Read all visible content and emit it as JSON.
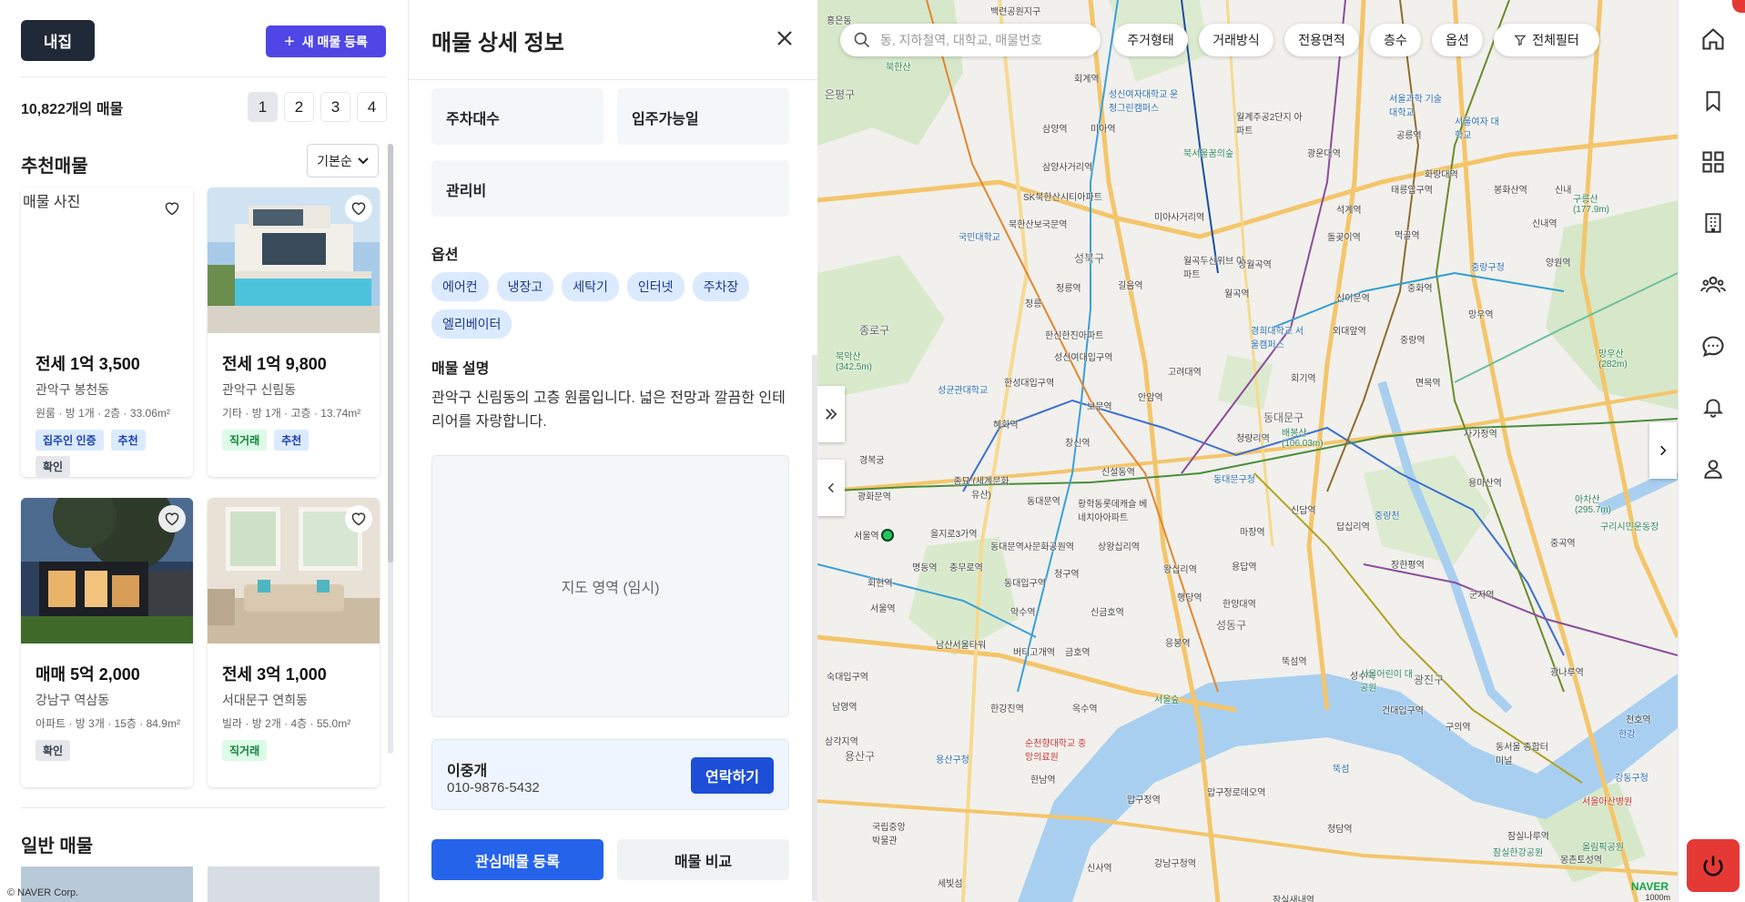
{
  "list_panel": {
    "my_button": "내집",
    "new_listing_button": "새 매물 등록",
    "count_text": "10,822개의 매물",
    "pages": [
      "1",
      "2",
      "3",
      "4"
    ],
    "active_page": "1",
    "recommended_title": "추천매물",
    "sort_value": "기본순",
    "general_title": "일반 매물",
    "broken_image_alt": "매물 사진",
    "cards": [
      {
        "price": "전세 1억 3,500",
        "location": "관악구 봉천동",
        "meta": "원룸 · 방 1개 · 2층 · 33.06m²",
        "badges": [
          {
            "text": "집주인 인증",
            "color": "blue"
          },
          {
            "text": "추천",
            "color": "blue"
          },
          {
            "text": "확인",
            "color": "gray"
          }
        ]
      },
      {
        "price": "전세 1억 9,800",
        "location": "관악구 신림동",
        "meta": "기타 · 방 1개 · 고층 · 13.74m²",
        "badges": [
          {
            "text": "직거래",
            "color": "green"
          },
          {
            "text": "추천",
            "color": "blue"
          }
        ]
      },
      {
        "price": "매매 5억 2,000",
        "location": "강남구 역삼동",
        "meta": "아파트 · 방 3개 · 15층 · 84.9m²",
        "badges": [
          {
            "text": "확인",
            "color": "gray"
          }
        ]
      },
      {
        "price": "전세 3억 1,000",
        "location": "서대문구 연희동",
        "meta": "빌라 · 방 2개 · 4층 · 55.0m²",
        "badges": [
          {
            "text": "직거래",
            "color": "green"
          }
        ]
      }
    ],
    "footer": "© NAVER Corp."
  },
  "detail": {
    "title": "매물 상세 정보",
    "info_boxes": [
      "주차대수",
      "입주가능일",
      "관리비"
    ],
    "options_title": "옵션",
    "options": [
      "에어컨",
      "냉장고",
      "세탁기",
      "인터넷",
      "주차장",
      "엘리베이터"
    ],
    "description_title": "매물 설명",
    "description": "관악구 신림동의 고층 원룸입니다. 넓은 전망과 깔끔한 인테리어를 자랑합니다.",
    "map_placeholder": "지도 영역 (임시)",
    "agent_name": "이중개",
    "agent_phone": "010-9876-5432",
    "contact_button": "연락하기",
    "favorite_button": "관심매물 등록",
    "compare_button": "매물 비교"
  },
  "map": {
    "search_placeholder": "동, 지하철역, 대학교, 매물번호",
    "filters": [
      "주거형태",
      "거래방식",
      "전용면적",
      "층수",
      "옵션",
      "전체필터"
    ],
    "brand": "NAVER",
    "scale": "1000m",
    "labels": [
      {
        "t": "백련공원지구",
        "c": ""
      },
      {
        "t": "은평구",
        "c": "big"
      },
      {
        "t": "홍은동",
        "c": ""
      },
      {
        "t": "북한산",
        "c": "green"
      },
      {
        "t": "회계역",
        "c": ""
      },
      {
        "t": "성신여자대학교 운정그린캠퍼스",
        "c": "blue"
      },
      {
        "t": "월계주공2단지 아파트",
        "c": ""
      },
      {
        "t": "서울과학 기술대학교",
        "c": "blue"
      },
      {
        "t": "서울여자 대학교",
        "c": "blue"
      },
      {
        "t": "삼양역",
        "c": ""
      },
      {
        "t": "미아역",
        "c": ""
      },
      {
        "t": "북서울꿈의숲",
        "c": "green"
      },
      {
        "t": "광운대역",
        "c": ""
      },
      {
        "t": "공릉역",
        "c": ""
      },
      {
        "t": "화랑대역",
        "c": ""
      },
      {
        "t": "봉화산역",
        "c": ""
      },
      {
        "t": "신내",
        "c": ""
      },
      {
        "t": "삼양사거리역",
        "c": ""
      },
      {
        "t": "석계역",
        "c": ""
      },
      {
        "t": "태릉입구역",
        "c": ""
      },
      {
        "t": "구릉산 (177.9m)",
        "c": "green"
      },
      {
        "t": "신내역",
        "c": ""
      },
      {
        "t": "미아사거리역",
        "c": ""
      },
      {
        "t": "SK북한산시티아파트",
        "c": ""
      },
      {
        "t": "북한산보국문역",
        "c": ""
      },
      {
        "t": "국민대학교",
        "c": "blue"
      },
      {
        "t": "돌곶이역",
        "c": ""
      },
      {
        "t": "먹골역",
        "c": ""
      },
      {
        "t": "중랑구청",
        "c": "blue"
      },
      {
        "t": "양원역",
        "c": ""
      },
      {
        "t": "성북구",
        "c": "big"
      },
      {
        "t": "월곡두산위브 아파트",
        "c": ""
      },
      {
        "t": "상월곡역",
        "c": ""
      },
      {
        "t": "정릉역",
        "c": ""
      },
      {
        "t": "길음역",
        "c": ""
      },
      {
        "t": "정릉",
        "c": ""
      },
      {
        "t": "월곡역",
        "c": ""
      },
      {
        "t": "신이문역",
        "c": ""
      },
      {
        "t": "중화역",
        "c": ""
      },
      {
        "t": "망우역",
        "c": ""
      },
      {
        "t": "종로구",
        "c": "big"
      },
      {
        "t": "한신한진아파트",
        "c": ""
      },
      {
        "t": "북악산 (342.5m)",
        "c": "green"
      },
      {
        "t": "경희대학교 서울캠퍼스",
        "c": "blue"
      },
      {
        "t": "외대앞역",
        "c": ""
      },
      {
        "t": "중랑역",
        "c": ""
      },
      {
        "t": "망우산 (282m)",
        "c": "green"
      },
      {
        "t": "성신여대입구역",
        "c": ""
      },
      {
        "t": "고려대역",
        "c": ""
      },
      {
        "t": "회기역",
        "c": ""
      },
      {
        "t": "면목역",
        "c": ""
      },
      {
        "t": "성균관대학교",
        "c": "blue"
      },
      {
        "t": "한성대입구역",
        "c": ""
      },
      {
        "t": "안암역",
        "c": ""
      },
      {
        "t": "보문역",
        "c": ""
      },
      {
        "t": "동대문구",
        "c": "big"
      },
      {
        "t": "배봉산 (106.03m)",
        "c": "green"
      },
      {
        "t": "혜화역",
        "c": ""
      },
      {
        "t": "청량리역",
        "c": ""
      },
      {
        "t": "사가정역",
        "c": ""
      },
      {
        "t": "경복궁",
        "c": ""
      },
      {
        "t": "창신역",
        "c": ""
      },
      {
        "t": "신설동역",
        "c": ""
      },
      {
        "t": "동대문구청",
        "c": "blue"
      },
      {
        "t": "용마산역",
        "c": ""
      },
      {
        "t": "종묘 (세계문화유산)",
        "c": ""
      },
      {
        "t": "광화문역",
        "c": ""
      },
      {
        "t": "동대문역",
        "c": ""
      },
      {
        "t": "황학동롯데캐슬 베네치아아파트",
        "c": ""
      },
      {
        "t": "신답역",
        "c": ""
      },
      {
        "t": "답십리역",
        "c": ""
      },
      {
        "t": "중랑천",
        "c": "blue"
      },
      {
        "t": "아차산 (295.7m)",
        "c": "green"
      },
      {
        "t": "구리시민운동장",
        "c": "green"
      },
      {
        "t": "서울역",
        "c": ""
      },
      {
        "t": "을지로3가역",
        "c": ""
      },
      {
        "t": "동대문역사문화공원역",
        "c": ""
      },
      {
        "t": "상왕십리역",
        "c": ""
      },
      {
        "t": "마장역",
        "c": ""
      },
      {
        "t": "장한평역",
        "c": ""
      },
      {
        "t": "군자역",
        "c": ""
      },
      {
        "t": "중곡역",
        "c": ""
      },
      {
        "t": "명동역",
        "c": ""
      },
      {
        "t": "충무로역",
        "c": ""
      },
      {
        "t": "청구역",
        "c": ""
      },
      {
        "t": "왕십리역",
        "c": ""
      },
      {
        "t": "용답역",
        "c": ""
      },
      {
        "t": "회현역",
        "c": ""
      },
      {
        "t": "동대입구역",
        "c": ""
      },
      {
        "t": "행당역",
        "c": ""
      },
      {
        "t": "서울역",
        "c": ""
      },
      {
        "t": "약수역",
        "c": ""
      },
      {
        "t": "신금호역",
        "c": ""
      },
      {
        "t": "한양대역",
        "c": ""
      },
      {
        "t": "성동구",
        "c": "big"
      },
      {
        "t": "남산서울타워",
        "c": ""
      },
      {
        "t": "버티고개역",
        "c": ""
      },
      {
        "t": "금호역",
        "c": ""
      },
      {
        "t": "응봉역",
        "c": ""
      },
      {
        "t": "뚝섬역",
        "c": ""
      },
      {
        "t": "성수역",
        "c": ""
      },
      {
        "t": "서울어린이 대공원",
        "c": "green"
      },
      {
        "t": "광진구",
        "c": "big"
      },
      {
        "t": "광나루역",
        "c": ""
      },
      {
        "t": "숙대입구역",
        "c": ""
      },
      {
        "t": "옥수역",
        "c": ""
      },
      {
        "t": "서울숲",
        "c": "green"
      },
      {
        "t": "건대입구역",
        "c": ""
      },
      {
        "t": "한강",
        "c": "blue"
      },
      {
        "t": "남영역",
        "c": ""
      },
      {
        "t": "한강진역",
        "c": ""
      },
      {
        "t": "구의역",
        "c": ""
      },
      {
        "t": "동서울 종합터미널",
        "c": ""
      },
      {
        "t": "천호역",
        "c": ""
      },
      {
        "t": "삼각지역",
        "c": ""
      },
      {
        "t": "순천향대학교 중앙의료원",
        "c": "red"
      },
      {
        "t": "용산구",
        "c": "big"
      },
      {
        "t": "용산구청",
        "c": "blue"
      },
      {
        "t": "뚝섬",
        "c": "blue"
      },
      {
        "t": "서울아산병원",
        "c": "red"
      },
      {
        "t": "강동구청",
        "c": "blue"
      },
      {
        "t": "한남역",
        "c": ""
      },
      {
        "t": "압구정역",
        "c": ""
      },
      {
        "t": "압구정로데오역",
        "c": ""
      },
      {
        "t": "청담역",
        "c": ""
      },
      {
        "t": "잠실나루역",
        "c": ""
      },
      {
        "t": "국립중앙 박물관",
        "c": ""
      },
      {
        "t": "신사역",
        "c": ""
      },
      {
        "t": "강남구청역",
        "c": ""
      },
      {
        "t": "잠실한강공원",
        "c": "green"
      },
      {
        "t": "몽촌토성역",
        "c": ""
      },
      {
        "t": "올림픽공원",
        "c": "green"
      },
      {
        "t": "세빛섬",
        "c": ""
      },
      {
        "t": "잠실새내역",
        "c": ""
      }
    ]
  },
  "rail": {
    "icons": [
      "home-icon",
      "bookmark-icon",
      "grid-icon",
      "building-icon",
      "users-icon",
      "chat-icon",
      "bell-icon",
      "user-icon"
    ]
  },
  "colors": {
    "primary": "#2563eb",
    "new_listing": "#4f46e5",
    "dark": "#1f2937",
    "power": "#e53935"
  }
}
